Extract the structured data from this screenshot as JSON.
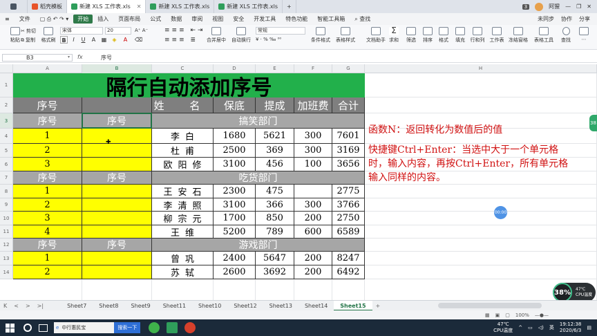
{
  "titlebar": {
    "tabs": [
      {
        "label": "",
        "icon": "home-icon",
        "active": false
      },
      {
        "label": "稻壳模板",
        "icon": "template-icon",
        "active": false
      },
      {
        "label": "新建 XLS 工作表.xls",
        "icon": "sheet-icon",
        "active": true
      },
      {
        "label": "新建 XLS 工作表.xls",
        "icon": "sheet-icon",
        "active": false
      },
      {
        "label": "新建 XLS 工作表.xls",
        "icon": "sheet-icon",
        "active": false
      }
    ],
    "count_badge": "3",
    "user": "阿猩"
  },
  "menubar": {
    "file": "文件",
    "items": [
      "开始",
      "插入",
      "页面布局",
      "公式",
      "数据",
      "审阅",
      "视图",
      "安全",
      "开发工具",
      "特色功能",
      "智能工具箱"
    ],
    "search": "查找",
    "right": [
      "未同步",
      "协作",
      "分享"
    ]
  },
  "ribbon": {
    "paste": "粘贴",
    "cut": "剪切",
    "copy": "复制",
    "format_painter": "格式刷",
    "font_name": "宋体",
    "font_size": "20",
    "bold": "B",
    "italic": "I",
    "underline": "U",
    "merge": "合并居中",
    "wrap": "自动换行",
    "number_format": "常规",
    "conditional": "条件格式",
    "table_style": "表格样式",
    "doc_helper": "文档助手",
    "sum": "求和",
    "filter": "筛选",
    "sort": "排序",
    "format": "格式",
    "fill": "填充",
    "rowcol": "行和列",
    "worksheet": "工作表",
    "freeze": "冻结窗格",
    "table_tools": "表格工具",
    "find": "查找"
  },
  "formulabar": {
    "cell_ref": "B3",
    "fx": "fx",
    "content": "序号"
  },
  "columns": [
    "A",
    "B",
    "C",
    "D",
    "E",
    "F",
    "G",
    "H"
  ],
  "selected_column": "B",
  "selected_row": "3",
  "rows": [
    "1",
    "2",
    "3",
    "4",
    "5",
    "6",
    "7",
    "8",
    "9",
    "10",
    "11",
    "12",
    "13",
    "14"
  ],
  "sheet": {
    "title": "隔行自动添加序号",
    "header": [
      "序号",
      "",
      "姓 名",
      "保底",
      "提成",
      "加班费",
      "合计"
    ],
    "sections": [
      {
        "seq_a": "序号",
        "seq_b": "序号",
        "name": "搞笑部门",
        "rows": [
          {
            "no": "1",
            "b": "",
            "name": "李白",
            "base": "1680",
            "comm": "5621",
            "ot": "300",
            "total": "7601"
          },
          {
            "no": "2",
            "b": "",
            "name": "杜甫",
            "base": "2500",
            "comm": "369",
            "ot": "300",
            "total": "3169"
          },
          {
            "no": "3",
            "b": "",
            "name": "欧阳修",
            "base": "3100",
            "comm": "456",
            "ot": "100",
            "total": "3656"
          }
        ]
      },
      {
        "seq_a": "序号",
        "seq_b": "序号",
        "name": "吃货部门",
        "rows": [
          {
            "no": "1",
            "b": "",
            "name": "王安石",
            "base": "2300",
            "comm": "475",
            "ot": "",
            "total": "2775"
          },
          {
            "no": "2",
            "b": "",
            "name": "李清照",
            "base": "3100",
            "comm": "366",
            "ot": "300",
            "total": "3766"
          },
          {
            "no": "3",
            "b": "",
            "name": "柳宗元",
            "base": "1700",
            "comm": "850",
            "ot": "200",
            "total": "2750"
          },
          {
            "no": "4",
            "b": "",
            "name": "王维",
            "base": "5200",
            "comm": "789",
            "ot": "600",
            "total": "6589"
          }
        ]
      },
      {
        "seq_a": "序号",
        "seq_b": "序号",
        "name": "游戏部门",
        "rows": [
          {
            "no": "1",
            "b": "",
            "name": "曾巩",
            "base": "2400",
            "comm": "5647",
            "ot": "200",
            "total": "8247"
          },
          {
            "no": "2",
            "b": "",
            "name": "苏轼",
            "base": "2600",
            "comm": "3692",
            "ot": "200",
            "total": "6492"
          }
        ]
      }
    ],
    "note1": "函数N：返回转化为数值后的值",
    "note2": "快捷键Ctrl+Enter：当选中大于一个单元格时，输入内容，再按Ctrl+Enter，所有单元格输入同样的内容。"
  },
  "sheettabs": [
    "Sheet7",
    "Sheet8",
    "Sheet9",
    "Sheet11",
    "Sheet10",
    "Sheet12",
    "Sheet13",
    "Sheet14",
    "Sheet15"
  ],
  "active_sheet": "Sheet15",
  "statusbar": {
    "zoom": "100%"
  },
  "taskbar": {
    "app": "中行惠民宝",
    "search_button": "搜索一下",
    "temp": "47℃",
    "cpu": "CPU温度",
    "time": "19:12:38",
    "date": "2020/6/3",
    "ime": "英"
  },
  "widgets": {
    "cpu_percent": "38%",
    "cpu_temp": "47℃",
    "cpu_label": "CPU温度",
    "timer": "00:00"
  },
  "colors": {
    "title_green": "#22b04b",
    "header_gray": "#7f7f7f",
    "section_gray": "#a6a6a6",
    "seq_yellow": "#ffff00",
    "note_red": "#d01010",
    "accent": "#217346"
  }
}
